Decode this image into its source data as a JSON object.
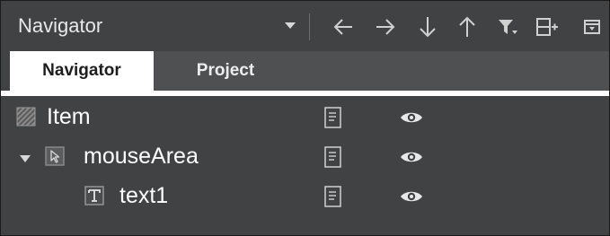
{
  "toolbar": {
    "view_selector": {
      "value": "Navigator",
      "icon": "chevron-down-icon"
    },
    "buttons": [
      {
        "name": "move-left-button",
        "icon": "arrow-left-icon"
      },
      {
        "name": "move-right-button",
        "icon": "arrow-right-icon"
      },
      {
        "name": "move-down-button",
        "icon": "arrow-down-icon"
      },
      {
        "name": "move-up-button",
        "icon": "arrow-up-icon"
      },
      {
        "name": "filter-button",
        "icon": "filter-icon"
      },
      {
        "name": "split-view-button",
        "icon": "split-add-icon"
      },
      {
        "name": "close-view-button",
        "icon": "collapse-icon"
      }
    ]
  },
  "tabs": [
    {
      "label": "Navigator",
      "active": true
    },
    {
      "label": "Project",
      "active": false
    }
  ],
  "tree": {
    "items": [
      {
        "label": "Item",
        "type_icon": "item-icon",
        "expanded": null,
        "depth": 0
      },
      {
        "label": "mouseArea",
        "type_icon": "mouse-area-icon",
        "expanded": true,
        "depth": 0
      },
      {
        "label": "text1",
        "type_icon": "text-icon",
        "expanded": null,
        "depth": 1
      }
    ],
    "row_icons": {
      "export": "document-icon",
      "visibility": "eye-icon"
    }
  },
  "colors": {
    "panel_bg": "#404244",
    "tab_strip_bg": "#4e5052",
    "active_tab_bg": "#ffffff",
    "text": "#ffffff",
    "icon": "#d0d0d0"
  }
}
